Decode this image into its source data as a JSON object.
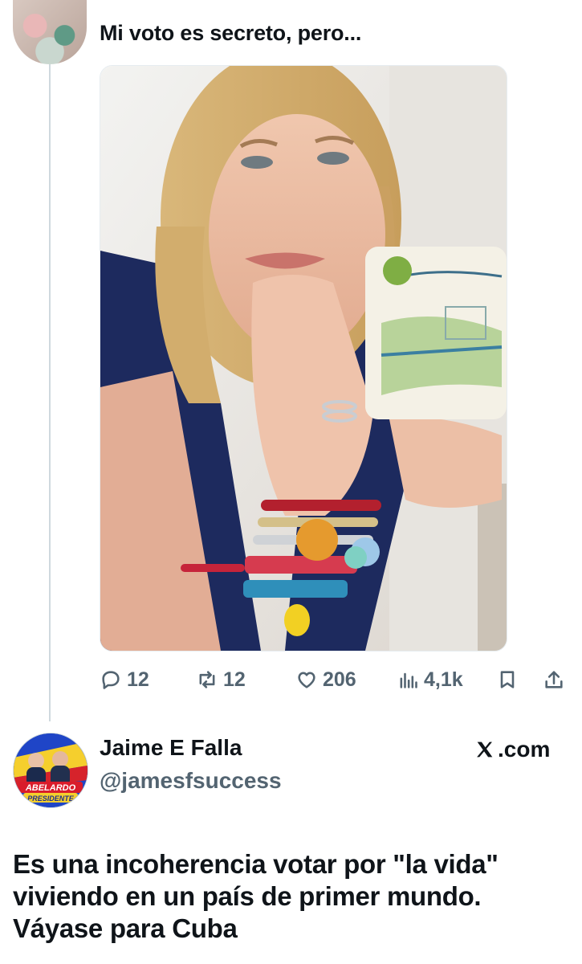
{
  "tweet": {
    "text": "Mi voto es secreto, pero...",
    "avatar_icon": "user-avatar-photo",
    "media_icon": "woman-with-mug-photo",
    "actions": {
      "replies": "12",
      "reposts": "12",
      "likes": "206",
      "views": "4,1k"
    },
    "icons": {
      "reply": "reply-icon",
      "repost": "repost-icon",
      "like": "heart-icon",
      "views": "views-icon",
      "bookmark": "bookmark-icon",
      "share": "share-icon"
    }
  },
  "reply": {
    "name": "Jaime E Falla",
    "handle": "@jamesfsuccess",
    "source": ".com",
    "avatar_text": [
      "ABELARDO",
      "PRESIDENTE"
    ],
    "lines": [
      "Es una incoherencia votar por \"la vida\"",
      "viviendo en un país de primer mundo.",
      "Váyase para Cuba"
    ]
  },
  "colors": {
    "text": "#0f1419",
    "secondary": "#536471",
    "divider": "#cfd9de"
  }
}
